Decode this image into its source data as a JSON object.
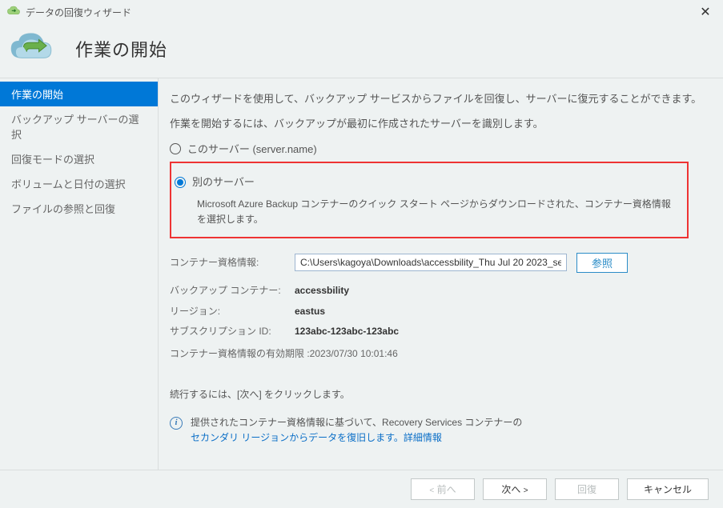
{
  "titlebar": {
    "title": "データの回復ウィザード"
  },
  "header": {
    "title": "作業の開始"
  },
  "sidebar": {
    "items": [
      {
        "label": "作業の開始",
        "active": true
      },
      {
        "label": "バックアップ サーバーの選択"
      },
      {
        "label": "回復モードの選択"
      },
      {
        "label": "ボリュームと日付の選択"
      },
      {
        "label": "ファイルの参照と回復"
      }
    ]
  },
  "main": {
    "intro1": "このウィザードを使用して、バックアップ サービスからファイルを回復し、サーバーに復元することができます。",
    "intro2": "作業を開始するには、バックアップが最初に作成されたサーバーを識別します。",
    "radio_this": "このサーバー (server.name)",
    "radio_other": "別のサーバー",
    "radio_other_desc": "Microsoft Azure Backup コンテナーのクイック スタート ページからダウンロードされた、コンテナー資格情報を選択します。",
    "cred_label": "コンテナー資格情報:",
    "cred_value": "C:\\Users\\kagoya\\Downloads\\accessbility_Thu Jul 20 2023_se",
    "browse": "参照",
    "container_label": "バックアップ コンテナー:",
    "container_value": "accessbility",
    "region_label": "リージョン:",
    "region_value": "eastus",
    "sub_label": "サブスクリプション ID:",
    "sub_value": "123abc-123abc-123abc",
    "expiry_label": "コンテナー資格情報の有効期限 : ",
    "expiry_value": "2023/07/30 10:01:46",
    "continue": "続行するには、[次へ] をクリックします。",
    "info_text1": "提供されたコンテナー資格情報に基づいて、Recovery Services コンテナーの",
    "info_link": "セカンダリ リージョンからデータを復旧します。詳細情報"
  },
  "footer": {
    "prev": "前へ",
    "next": "次へ",
    "recover": "回復",
    "cancel": "キャンセル"
  }
}
